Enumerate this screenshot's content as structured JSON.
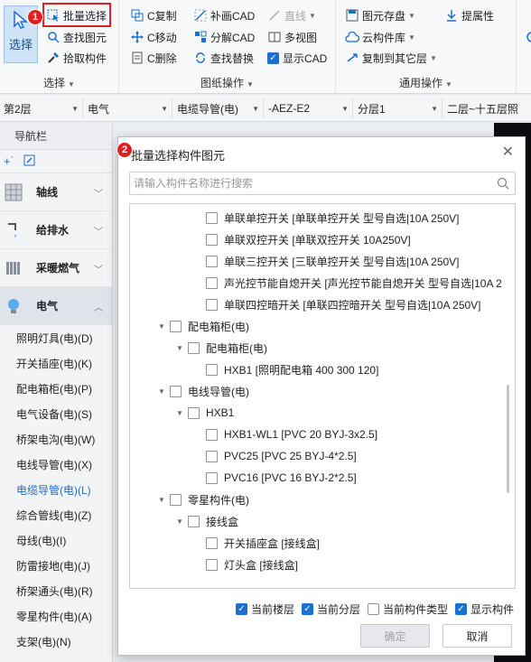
{
  "ribbon": {
    "select_label": "选择",
    "select_group_label": "选择",
    "batch_select": "批量选择",
    "find_element": "查找图元",
    "pick_component": "拾取构件",
    "copy": "C复制",
    "move": "C移动",
    "delete": "C删除",
    "fill_cad": "补画CAD",
    "decompose_cad": "分解CAD",
    "find_replace": "查找替换",
    "line": "直线",
    "multi_view": "多视图",
    "show_cad": "显示CAD",
    "drawing_ops_label": "图纸操作",
    "element_save": "图元存盘",
    "cloud_lib": "云构件库",
    "copy_to_floor": "复制到其它层",
    "extract_attr": "提属性",
    "common_ops_label": "通用操作"
  },
  "toolbar": {
    "floor": "第2层",
    "discipline": "电气",
    "type": "电缆导管(电)",
    "component": "-AEZ-E2",
    "layer": "分层1",
    "view": "二层~十五层照"
  },
  "nav": {
    "title": "导航栏",
    "categories": [
      {
        "label": "轴线"
      },
      {
        "label": "给排水"
      },
      {
        "label": "采暖燃气"
      },
      {
        "label": "电气"
      }
    ],
    "items": [
      {
        "label": "照明灯具(电)(D)"
      },
      {
        "label": "开关插座(电)(K)"
      },
      {
        "label": "配电箱柜(电)(P)"
      },
      {
        "label": "电气设备(电)(S)"
      },
      {
        "label": "桥架电沟(电)(W)"
      },
      {
        "label": "电线导管(电)(X)"
      },
      {
        "label": "电缆导管(电)(L)"
      },
      {
        "label": "综合管线(电)(Z)"
      },
      {
        "label": "母线(电)(I)"
      },
      {
        "label": "防雷接地(电)(J)"
      },
      {
        "label": "桥架通头(电)(R)"
      },
      {
        "label": "零星构件(电)(A)"
      },
      {
        "label": "支架(电)(N)"
      }
    ]
  },
  "badges": {
    "one": "1",
    "two": "2"
  },
  "dialog": {
    "title": "批量选择构件图元",
    "search_placeholder": "请输入构件名称进行搜索",
    "tree": [
      {
        "label": "单联单控开关 [单联单控开关 型号自选|10A 250V]"
      },
      {
        "label": "单联双控开关 [单联双控开关 10A250V]"
      },
      {
        "label": "单联三控开关 [三联单控开关 型号自选|10A 250V]"
      },
      {
        "label": "声光控节能自熄开关 [声光控节能自熄开关 型号自选|10A 2"
      },
      {
        "label": "单联四控暗开关 [单联四控暗开关 型号自选|10A 250V]"
      },
      {
        "label": "配电箱柜(电)"
      },
      {
        "label": "配电箱柜(电)"
      },
      {
        "label": "HXB1 [照明配电箱 400 300 120]"
      },
      {
        "label": "电线导管(电)"
      },
      {
        "label": "HXB1"
      },
      {
        "label": "HXB1-WL1 [PVC 20 BYJ-3x2.5]"
      },
      {
        "label": "PVC25 [PVC 25 BYJ-4*2.5]"
      },
      {
        "label": "PVC16 [PVC 16 BYJ-2*2.5]"
      },
      {
        "label": "零星构件(电)"
      },
      {
        "label": "接线盒"
      },
      {
        "label": "开关插座盒 [接线盒]"
      },
      {
        "label": "灯头盒 [接线盒]"
      }
    ],
    "options": [
      {
        "label": "当前楼层",
        "checked": true
      },
      {
        "label": "当前分层",
        "checked": true
      },
      {
        "label": "当前构件类型",
        "checked": false
      },
      {
        "label": "显示构件",
        "checked": true
      }
    ],
    "ok_label": "确定",
    "cancel_label": "取消"
  }
}
